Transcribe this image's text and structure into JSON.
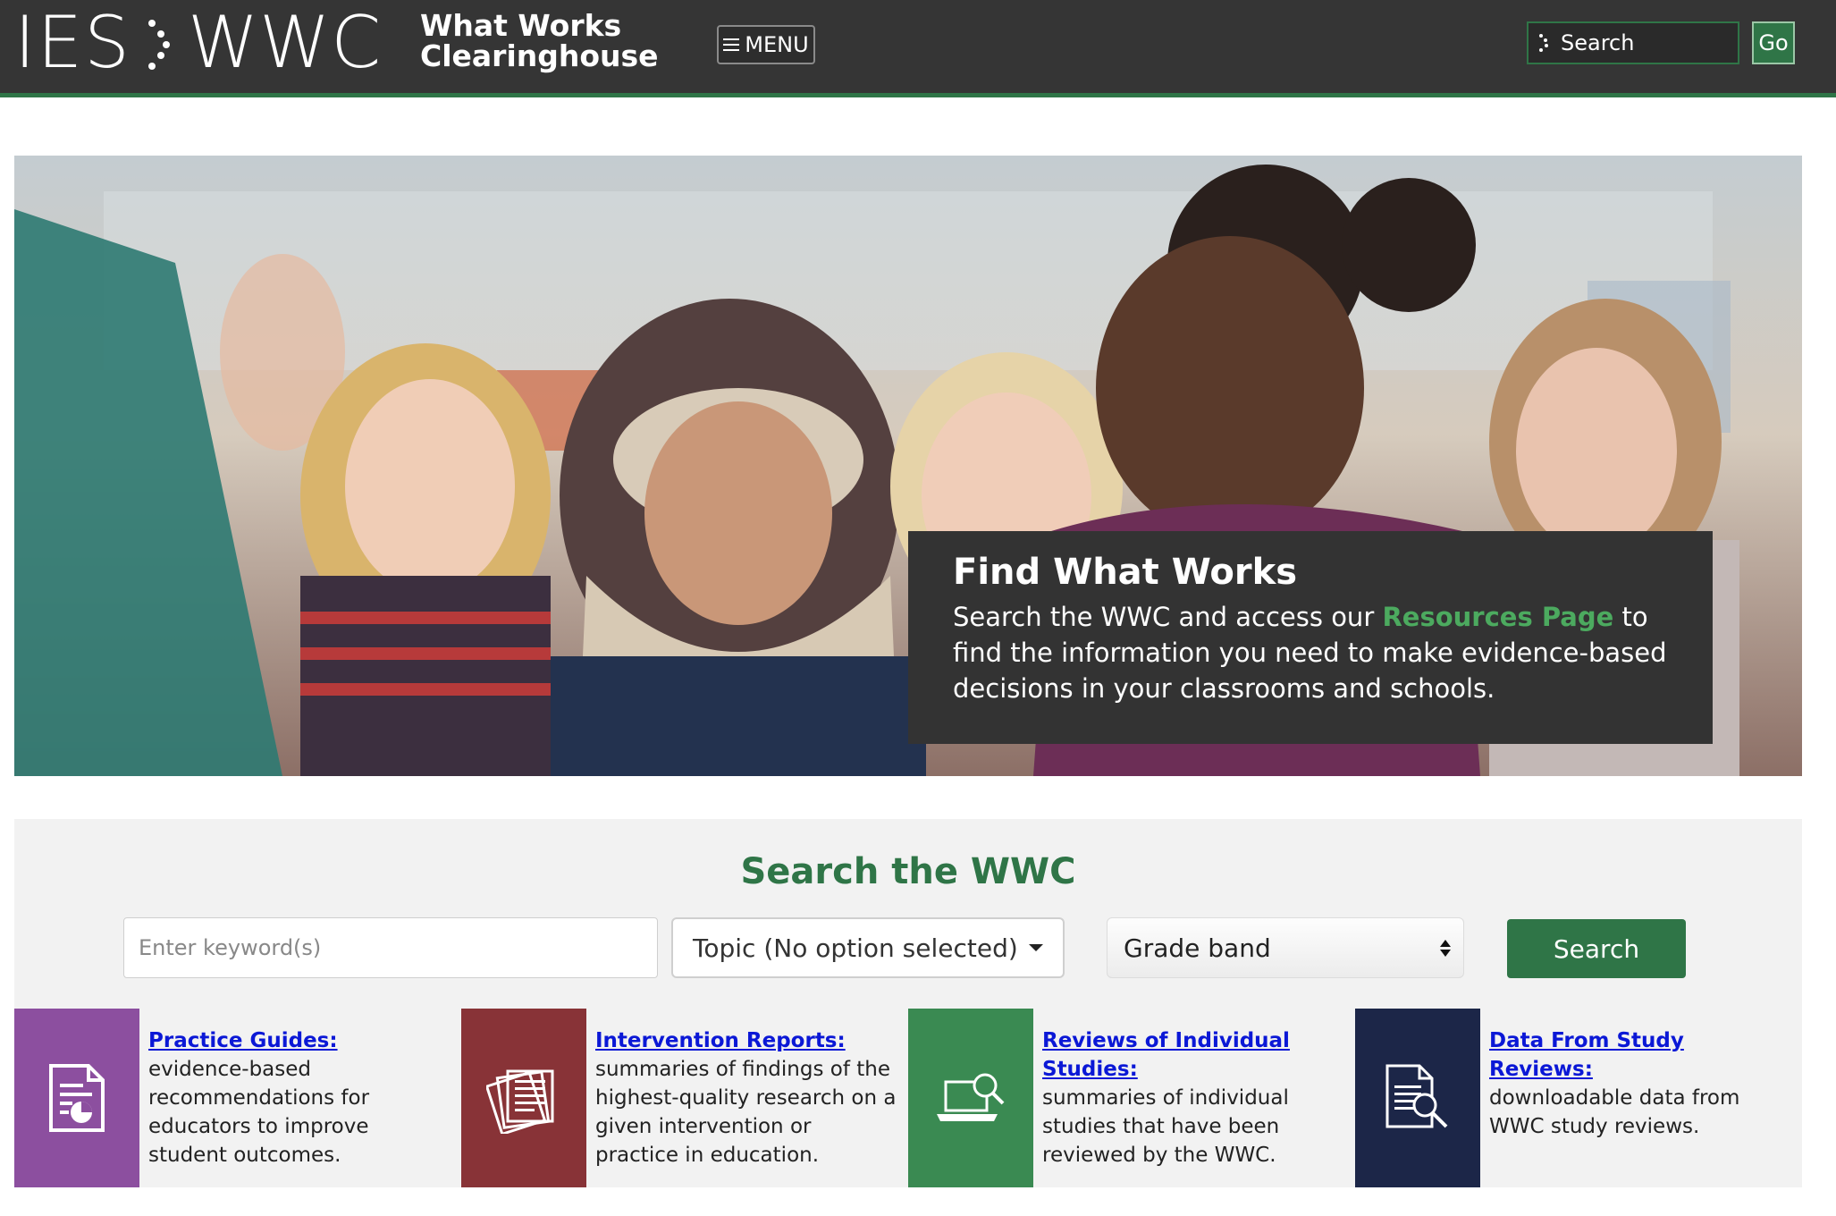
{
  "header": {
    "logo_ies": "IES",
    "logo_wwc": "WWC",
    "tagline_line1": "What Works",
    "tagline_line2": "Clearinghouse",
    "menu_label": "MENU",
    "search_placeholder": "Search",
    "go_label": "Go"
  },
  "hero": {
    "title": "Find What Works",
    "text_before": "Search the WWC and access our ",
    "link_label": "Resources Page",
    "text_after": " to find the information you need to make evidence-based decisions in your classrooms and schools."
  },
  "search": {
    "heading": "Search the WWC",
    "keyword_placeholder": "Enter keyword(s)",
    "topic_label": "Topic (No option selected)",
    "grade_label": "Grade band",
    "button_label": "Search"
  },
  "tiles": [
    {
      "title": "Practice Guides:",
      "desc": "evidence-based recommendations for educators to improve student outcomes.",
      "color": "#8c4f9f",
      "icon": "document-chart-icon"
    },
    {
      "title": "Intervention Reports:",
      "desc": "summaries of findings of the highest-quality research on a given intervention or practice in education.",
      "color": "#883337",
      "icon": "stacked-papers-icon"
    },
    {
      "title": "Reviews of Individual Studies:",
      "desc": "summaries of individual studies that have been reviewed by the WWC.",
      "color": "#3a8a52",
      "icon": "laptop-magnifier-icon"
    },
    {
      "title": "Data From Study Reviews:",
      "desc": "downloadable data from WWC study reviews.",
      "color": "#1c2648",
      "icon": "document-search-icon"
    }
  ],
  "colors": {
    "brand_green": "#2f7547",
    "header_bg": "#353535",
    "link_blue": "#0b18d6"
  }
}
